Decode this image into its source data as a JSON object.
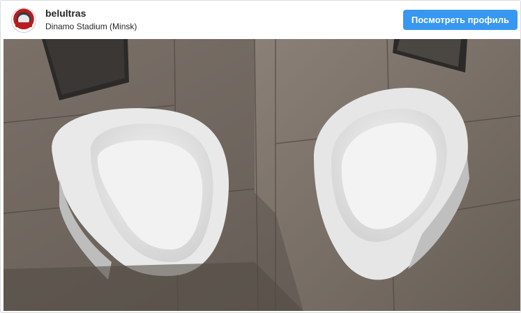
{
  "post": {
    "username": "belultras",
    "location": "Dinamo Stadium (Minsk)",
    "view_profile_label": "Посмотреть профиль",
    "avatar_icon": "belultras-logo-icon",
    "photo_description_icon": "post-photo"
  },
  "colors": {
    "button_bg": "#3897f0",
    "button_text": "#ffffff",
    "text": "#262626",
    "border": "#dbdbdb"
  }
}
